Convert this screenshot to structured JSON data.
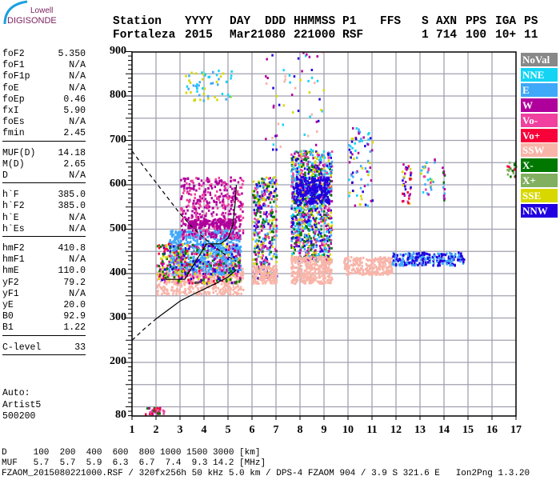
{
  "logo": {
    "line1": "Lowell",
    "line2": "DIGISONDE",
    "arc_color": "#1aa0e0",
    "text_color": "#7a1e5e"
  },
  "header": {
    "columns": [
      {
        "label": "Station",
        "value": "Fortaleza"
      },
      {
        "label": "YYYY",
        "value": "2015"
      },
      {
        "label": "DAY",
        "value": "Mar21"
      },
      {
        "label": "DDD",
        "value": "080"
      },
      {
        "label": "HHMMSS",
        "value": "221000"
      },
      {
        "label": "P1",
        "value": "RSF"
      },
      {
        "label": "FFS",
        "value": ""
      },
      {
        "label": "S",
        "value": "1"
      },
      {
        "label": "AXN",
        "value": "714"
      },
      {
        "label": "PPS",
        "value": "100"
      },
      {
        "label": "IGA",
        "value": "10+"
      },
      {
        "label": "PS",
        "value": "11"
      }
    ]
  },
  "params": {
    "group1": [
      {
        "k": "foF2",
        "v": "5.350"
      },
      {
        "k": "foF1",
        "v": "N/A"
      },
      {
        "k": "foF1p",
        "v": "N/A"
      },
      {
        "k": "foE",
        "v": "N/A"
      },
      {
        "k": "foEp",
        "v": "0.46"
      },
      {
        "k": "fxI",
        "v": "5.90"
      },
      {
        "k": "foEs",
        "v": "N/A"
      },
      {
        "k": "fmin",
        "v": "2.45"
      }
    ],
    "group2": [
      {
        "k": "MUF(D)",
        "v": "14.18"
      },
      {
        "k": "M(D)",
        "v": "2.65"
      },
      {
        "k": "D",
        "v": "N/A"
      }
    ],
    "group3": [
      {
        "k": "h`F",
        "v": "385.0"
      },
      {
        "k": "h`F2",
        "v": "385.0"
      },
      {
        "k": "h`E",
        "v": "N/A"
      },
      {
        "k": "h`Es",
        "v": "N/A"
      }
    ],
    "group4": [
      {
        "k": "hmF2",
        "v": "410.8"
      },
      {
        "k": "hmF1",
        "v": "N/A"
      },
      {
        "k": "hmE",
        "v": "110.0"
      },
      {
        "k": "yF2",
        "v": "79.2"
      },
      {
        "k": "yF1",
        "v": "N/A"
      },
      {
        "k": "yE",
        "v": "20.0"
      },
      {
        "k": "B0",
        "v": "92.9"
      },
      {
        "k": "B1",
        "v": "1.22"
      }
    ],
    "group5": [
      {
        "k": "C-level",
        "v": "33"
      }
    ],
    "auto": [
      "Auto:",
      "Artist5",
      "500200"
    ]
  },
  "legend": [
    {
      "label": "NoVal",
      "color": "#888888"
    },
    {
      "label": "NNE",
      "color": "#14d4f4"
    },
    {
      "label": "E",
      "color": "#40a8f8"
    },
    {
      "label": "W",
      "color": "#b0009c"
    },
    {
      "label": "Vo-",
      "color": "#f040a0"
    },
    {
      "label": "Vo+",
      "color": "#f80038"
    },
    {
      "label": "SSW",
      "color": "#f8b4a8"
    },
    {
      "label": "X-",
      "color": "#007800"
    },
    {
      "label": "X+",
      "color": "#80b060"
    },
    {
      "label": "SSE",
      "color": "#d8d800"
    },
    {
      "label": "NNW",
      "color": "#2000e0"
    }
  ],
  "footer": {
    "d_row": "D     100  200  400  600  800 1000 1500 3000 [km]",
    "muf_row": "MUF   5.7  5.7  5.9  6.3  6.7  7.4  9.3 14.2 [MHz]",
    "file_row": "FZAOM_2015080221000.RSF / 320fx256h 50 kHz 5.0 km / DPS-4 FZAOM 904 / 3.9 S 321.6 E   Ion2Png 1.3.20"
  },
  "chart_data": {
    "type": "scatter",
    "xlim": [
      1,
      17
    ],
    "ylim": [
      80,
      900
    ],
    "x_unit": "MHz",
    "y_unit": "km",
    "x_ticks": [
      "1",
      "2",
      "3",
      "4",
      "5",
      "6",
      "7",
      "8",
      "9",
      "10",
      "11",
      "12",
      "13",
      "14",
      "15",
      "16",
      "17"
    ],
    "y_ticks": [
      {
        "value": 900,
        "label": "900"
      },
      {
        "value": 800,
        "label": "800"
      },
      {
        "value": 700,
        "label": "700"
      },
      {
        "value": 600,
        "label": "600"
      },
      {
        "value": 500,
        "label": "500"
      },
      {
        "value": 400,
        "label": "400"
      },
      {
        "value": 300,
        "label": "300"
      },
      {
        "value": 200,
        "label": "200"
      },
      {
        "value": 80,
        "label": "80"
      }
    ],
    "grid": true,
    "legend_position": "right",
    "echo_regions": [
      {
        "f": [
          2.0,
          5.6
        ],
        "h": [
          355,
          420
        ],
        "n": 500,
        "classes": [
          "SSW"
        ]
      },
      {
        "f": [
          2.5,
          5.5
        ],
        "h": [
          400,
          500
        ],
        "n": 700,
        "classes": [
          "E"
        ]
      },
      {
        "f": [
          3.0,
          5.6
        ],
        "h": [
          480,
          620
        ],
        "n": 450,
        "classes": [
          "W",
          "W",
          "Vo-"
        ]
      },
      {
        "f": [
          3.3,
          5.3
        ],
        "h": [
          505,
          525
        ],
        "n": 150,
        "classes": [
          "W"
        ]
      },
      {
        "f": [
          2.0,
          5.5
        ],
        "h": [
          380,
          470
        ],
        "n": 400,
        "classes": [
          "SSE",
          "X-",
          "Vo-",
          "Vo+",
          "NNW",
          "W"
        ]
      },
      {
        "f": [
          3.2,
          5.2
        ],
        "h": [
          790,
          860
        ],
        "n": 60,
        "classes": [
          "E",
          "SSE",
          "NNE"
        ]
      },
      {
        "f": [
          6.0,
          7.0
        ],
        "h": [
          390,
          620
        ],
        "n": 400,
        "classes": [
          "W",
          "E",
          "Vo-",
          "SSE",
          "X-",
          "NNW"
        ]
      },
      {
        "f": [
          6.0,
          7.0
        ],
        "h": [
          380,
          420
        ],
        "n": 150,
        "classes": [
          "SSW"
        ]
      },
      {
        "f": [
          7.6,
          9.3
        ],
        "h": [
          430,
          680
        ],
        "n": 1000,
        "classes": [
          "E",
          "NNW",
          "W",
          "NNE",
          "SSE",
          "Vo-",
          "X-"
        ]
      },
      {
        "f": [
          7.8,
          9.2
        ],
        "h": [
          560,
          620
        ],
        "n": 250,
        "classes": [
          "NNW"
        ]
      },
      {
        "f": [
          7.6,
          9.3
        ],
        "h": [
          380,
          440
        ],
        "n": 350,
        "classes": [
          "SSW"
        ]
      },
      {
        "f": [
          9.8,
          11.8
        ],
        "h": [
          400,
          440
        ],
        "n": 250,
        "classes": [
          "SSW"
        ]
      },
      {
        "f": [
          10.0,
          11.0
        ],
        "h": [
          550,
          730
        ],
        "n": 80,
        "classes": [
          "NNE",
          "E",
          "W",
          "SSE",
          "NNW"
        ]
      },
      {
        "f": [
          11.8,
          14.8
        ],
        "h": [
          420,
          450
        ],
        "n": 250,
        "classes": [
          "NNW",
          "E"
        ]
      },
      {
        "f": [
          12.2,
          12.6
        ],
        "h": [
          560,
          660
        ],
        "n": 40,
        "classes": [
          "W",
          "Vo-",
          "NNW",
          "SSE",
          "Vo+"
        ]
      },
      {
        "f": [
          13.0,
          13.6
        ],
        "h": [
          580,
          660
        ],
        "n": 30,
        "classes": [
          "E",
          "Vo-",
          "SSE",
          "NNE",
          "W"
        ]
      },
      {
        "f": [
          13.9,
          14.0
        ],
        "h": [
          560,
          650
        ],
        "n": 15,
        "classes": [
          "E",
          "X-",
          "W"
        ]
      },
      {
        "f": [
          16.6,
          17.0
        ],
        "h": [
          620,
          660
        ],
        "n": 20,
        "classes": [
          "X-",
          "X+",
          "Vo+"
        ]
      },
      {
        "f": [
          1.5,
          2.3
        ],
        "h": [
          85,
          100
        ],
        "n": 40,
        "classes": [
          "Vo+",
          "Vo-",
          "X-",
          "W"
        ]
      },
      {
        "f": [
          6.5,
          9.0
        ],
        "h": [
          680,
          900
        ],
        "n": 60,
        "classes": [
          "SSE",
          "W",
          "NNE",
          "NNW",
          "SSW"
        ]
      }
    ],
    "traces": [
      {
        "style": "solid",
        "points": [
          [
            2.4,
            387
          ],
          [
            3.2,
            387
          ],
          [
            4.1,
            467
          ],
          [
            4.7,
            467
          ],
          [
            5.0,
            480
          ],
          [
            5.2,
            510
          ],
          [
            5.3,
            560
          ],
          [
            5.35,
            600
          ]
        ]
      },
      {
        "style": "dashed",
        "points": [
          [
            1.0,
            676
          ],
          [
            1.5,
            640
          ],
          [
            2.0,
            605
          ],
          [
            2.5,
            570
          ],
          [
            3.0,
            535
          ],
          [
            3.5,
            505
          ],
          [
            4.0,
            480
          ],
          [
            4.5,
            458
          ],
          [
            5.0,
            438
          ],
          [
            5.35,
            428
          ]
        ]
      },
      {
        "style": "dashed",
        "points": [
          [
            1.0,
            250
          ],
          [
            1.5,
            275
          ],
          [
            2.0,
            298
          ]
        ]
      },
      {
        "style": "solid",
        "points": [
          [
            2.0,
            298
          ],
          [
            2.5,
            318
          ],
          [
            3.0,
            338
          ],
          [
            3.5,
            352
          ],
          [
            4.0,
            365
          ],
          [
            4.5,
            378
          ],
          [
            5.0,
            392
          ],
          [
            5.35,
            409
          ]
        ]
      }
    ]
  }
}
